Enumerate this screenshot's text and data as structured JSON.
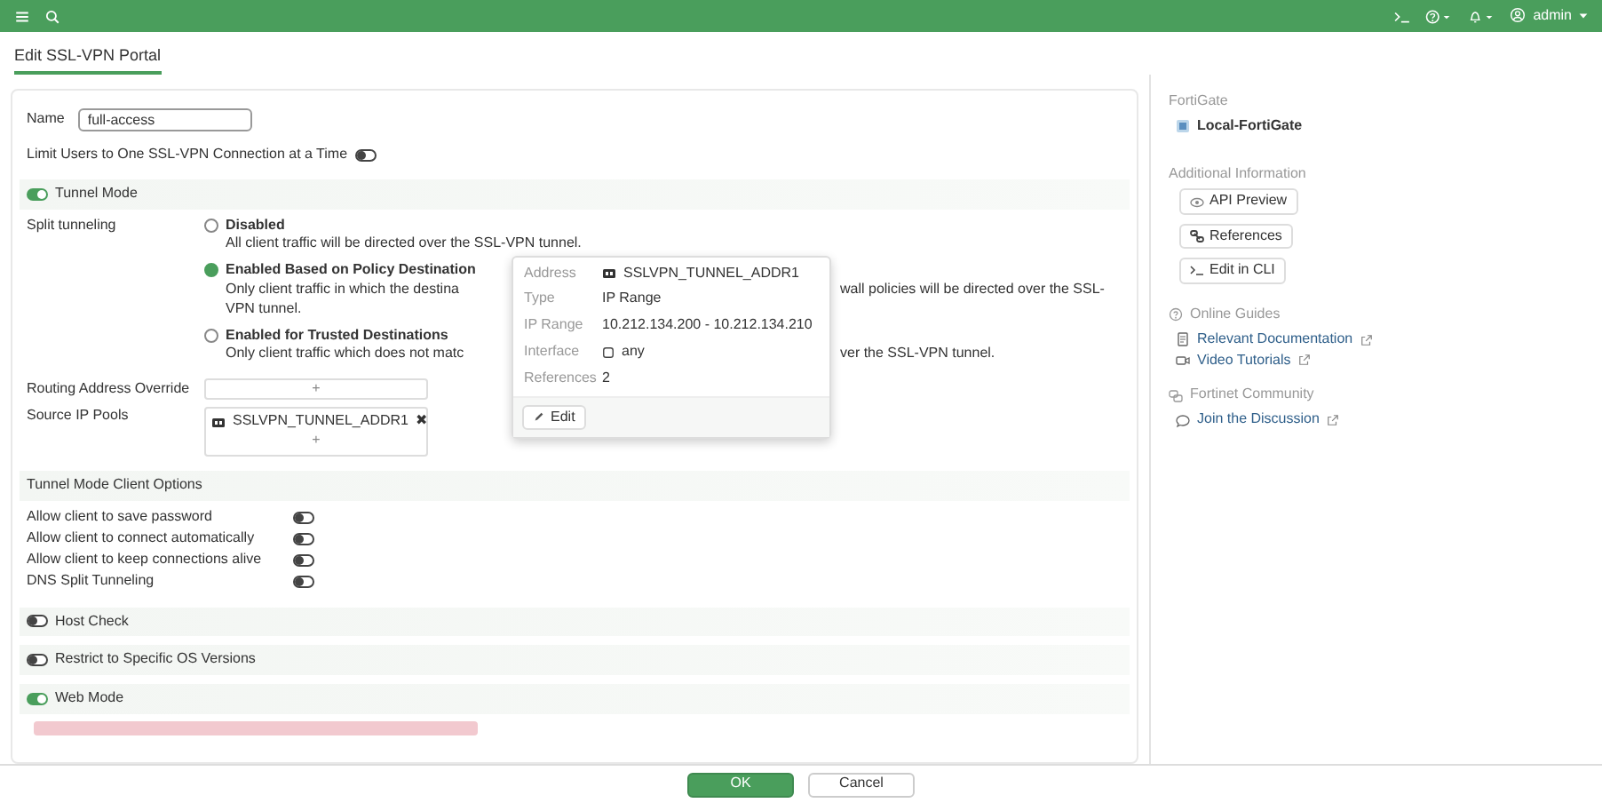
{
  "topbar": {
    "user": "admin"
  },
  "page_title": "Edit SSL-VPN Portal",
  "name_field": {
    "label": "Name",
    "value": "full-access"
  },
  "limit_users": {
    "label": "Limit Users to One SSL-VPN Connection at a Time",
    "on": false
  },
  "tunnel_mode": {
    "label": "Tunnel Mode",
    "on": true
  },
  "split_tunneling": {
    "label": "Split tunneling",
    "options": [
      {
        "title": "Disabled",
        "selected": false,
        "lines": [
          [
            "All client traffic will be directed over the SSL-VPN tunnel."
          ]
        ]
      },
      {
        "title": "Enabled Based on Policy Destination",
        "selected": true,
        "lines": [
          [
            "Only client traffic in which the destina",
            "wall policies will be directed over the SSL-"
          ],
          [
            "VPN tunnel."
          ]
        ]
      },
      {
        "title": "Enabled for Trusted Destinations",
        "selected": false,
        "lines": [
          [
            "Only client traffic which does not matc",
            "ver the SSL-VPN tunnel."
          ]
        ]
      }
    ]
  },
  "address_popover": {
    "rows": [
      {
        "label": "Address",
        "value": "SSLVPN_TUNNEL_ADDR1",
        "kind": "address"
      },
      {
        "label": "Type",
        "value": "IP Range",
        "kind": "text"
      },
      {
        "label": "IP Range",
        "value": "10.212.134.200 - 10.212.134.210",
        "kind": "text"
      },
      {
        "label": "Interface",
        "value": "any",
        "kind": "interface"
      },
      {
        "label": "References",
        "value": "2",
        "kind": "text"
      }
    ],
    "edit_button": "Edit"
  },
  "routing_override": {
    "label": "Routing Address Override",
    "add": "+"
  },
  "source_ip_pools": {
    "label": "Source IP Pools",
    "entries": [
      {
        "name": "SSLVPN_TUNNEL_ADDR1",
        "remove": "✖"
      }
    ],
    "add": "+"
  },
  "client_options": {
    "title": "Tunnel Mode Client Options",
    "items": [
      {
        "label": "Allow client to save password",
        "on": false
      },
      {
        "label": "Allow client to connect automatically",
        "on": false
      },
      {
        "label": "Allow client to keep connections alive",
        "on": false
      },
      {
        "label": "DNS Split Tunneling",
        "on": false
      }
    ]
  },
  "sections": [
    {
      "label": "Host Check",
      "on": false
    },
    {
      "label": "Restrict to Specific OS Versions",
      "on": false
    },
    {
      "label": "Web Mode",
      "on": true
    }
  ],
  "sidebar": {
    "device_heading": "FortiGate",
    "device": "Local-FortiGate",
    "info_heading": "Additional Information",
    "info_buttons": [
      {
        "label": "API Preview",
        "kind": "eye"
      },
      {
        "label": "References",
        "kind": "link"
      },
      {
        "label": "Edit in CLI",
        "kind": "cli"
      }
    ],
    "guides_heading": "Online Guides",
    "guide_links": [
      {
        "label": "Relevant Documentation",
        "kind": "document"
      },
      {
        "label": "Video Tutorials",
        "kind": "video"
      }
    ],
    "community_heading": "Fortinet Community",
    "community_links": [
      {
        "label": "Join the Discussion",
        "kind": "chat"
      }
    ]
  },
  "footer": {
    "ok": "OK",
    "cancel": "Cancel"
  }
}
